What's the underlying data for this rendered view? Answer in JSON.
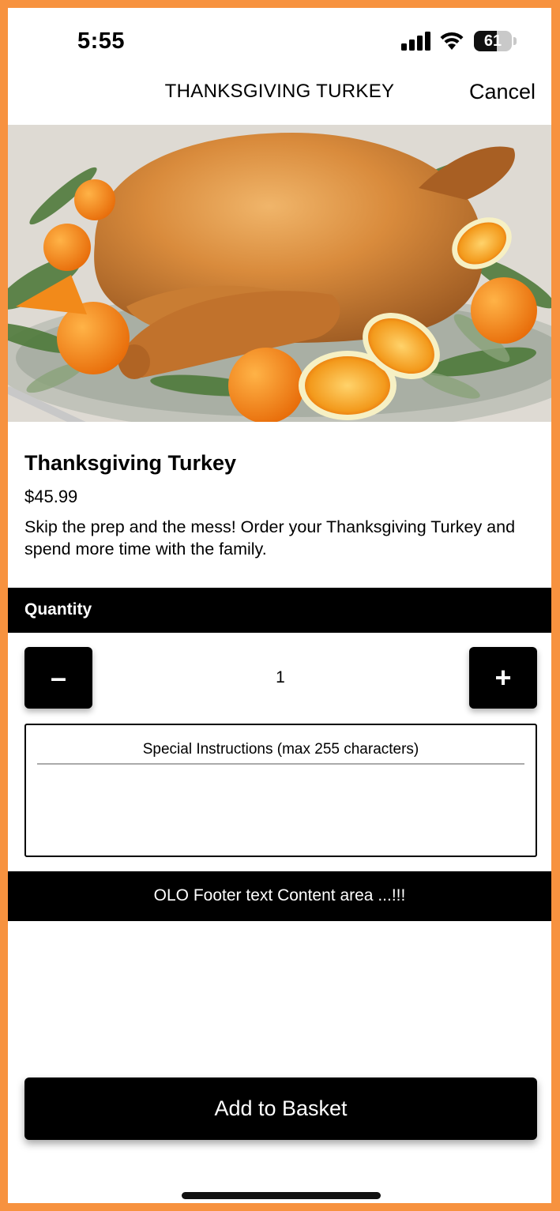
{
  "status_bar": {
    "time": "5:55",
    "battery": "61",
    "battery_level": 0.61,
    "icons": [
      "signal-icon",
      "wifi-icon",
      "battery-icon"
    ]
  },
  "nav": {
    "title": "THANKSGIVING TURKEY",
    "cancel_label": "Cancel"
  },
  "hero": {
    "image": "roast-turkey-with-oranges-photo"
  },
  "product": {
    "name": "Thanksgiving Turkey",
    "price": "$45.99",
    "description": "Skip the prep and the mess! Order your Thanksgiving Turkey and spend more time with the family."
  },
  "quantity": {
    "header": "Quantity",
    "minus_label": "–",
    "plus_label": "+",
    "value": "1"
  },
  "instructions": {
    "label": "Special Instructions",
    "hint": "(max 255 characters)",
    "value": ""
  },
  "footer": {
    "text": "OLO Footer text Content area ...!!!"
  },
  "actions": {
    "add_label": "Add to Basket"
  },
  "colors": {
    "frame": "#F7923F",
    "primary": "#000000",
    "background": "#FFFFFF"
  }
}
